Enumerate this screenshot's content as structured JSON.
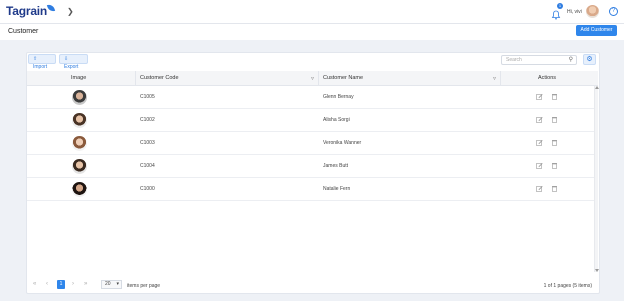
{
  "app": {
    "logo_text": "Tagrain"
  },
  "header": {
    "greeting": "Hi, vivi",
    "notification_count": "1",
    "help_label": "?"
  },
  "page": {
    "title": "Customer",
    "add_button": "Add Customer"
  },
  "toolbar": {
    "import_label": "Import",
    "export_label": "Export",
    "search_placeholder": "Search"
  },
  "table": {
    "columns": {
      "image": "Image",
      "code": "Customer Code",
      "name": "Customer Name",
      "actions": "Actions"
    },
    "rows": [
      {
        "code": "C1005",
        "name": "Glenn Bernay"
      },
      {
        "code": "C1002",
        "name": "Alisha Sorgi"
      },
      {
        "code": "C1003",
        "name": "Veronika Wanner"
      },
      {
        "code": "C1004",
        "name": "James Butt"
      },
      {
        "code": "C1000",
        "name": "Natalie Fern"
      }
    ]
  },
  "pager": {
    "first": "«",
    "prev": "‹",
    "current": "1",
    "next": "›",
    "last": "»",
    "page_size": "20",
    "items_label": "items per page",
    "info": "1 of 1 pages (5 items)"
  },
  "colors": {
    "accent": "#2f86eb",
    "brand": "#1f3a8a"
  }
}
